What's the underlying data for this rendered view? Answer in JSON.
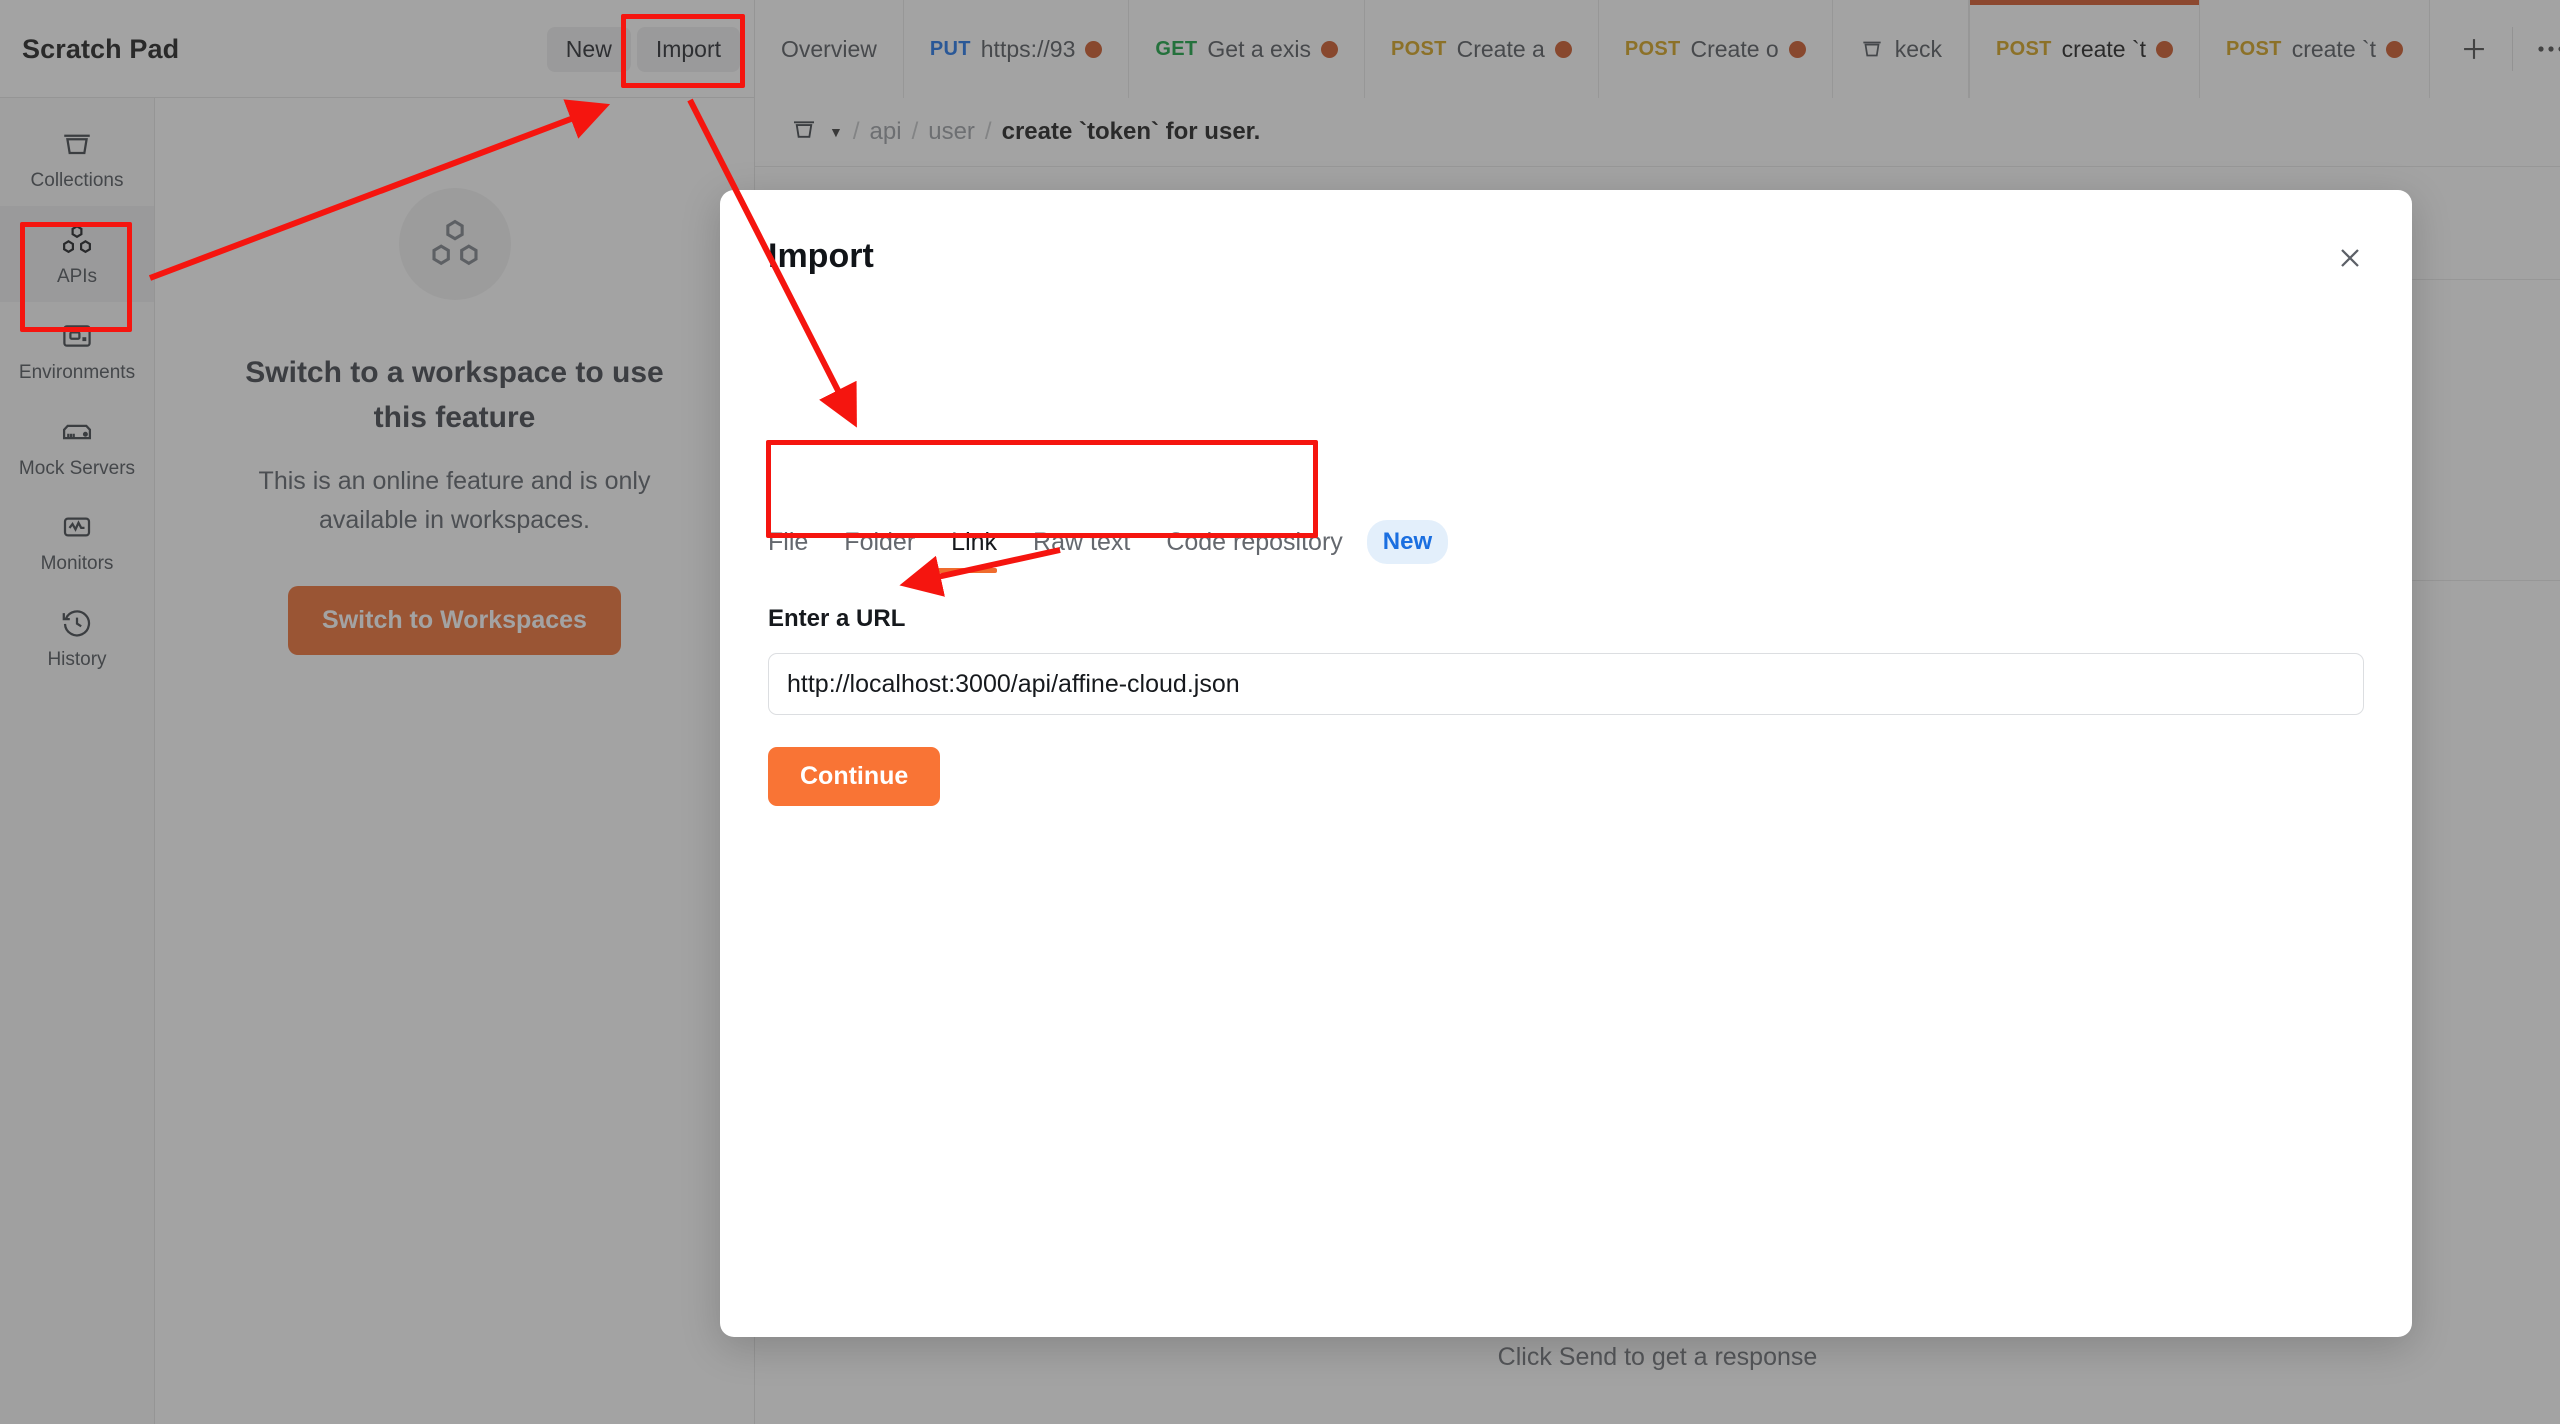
{
  "app": {
    "workspace_title": "Scratch Pad"
  },
  "toolbar": {
    "new_label": "New",
    "import_label": "Import"
  },
  "tabs": [
    {
      "method": "",
      "label": "Overview",
      "method_class": "",
      "dot": false,
      "icon": "",
      "active": false
    },
    {
      "method": "PUT",
      "label": "https://93",
      "method_class": "m-put",
      "dot": true,
      "icon": "",
      "active": false
    },
    {
      "method": "GET",
      "label": "Get a exis",
      "method_class": "m-get",
      "dot": true,
      "icon": "",
      "active": false
    },
    {
      "method": "POST",
      "label": "Create a",
      "method_class": "m-post",
      "dot": true,
      "icon": "",
      "active": false
    },
    {
      "method": "POST",
      "label": "Create o",
      "method_class": "m-post",
      "dot": true,
      "icon": "",
      "active": false
    },
    {
      "method": "",
      "label": "keck",
      "method_class": "",
      "dot": false,
      "icon": "collection-icon",
      "active": false
    },
    {
      "method": "POST",
      "label": "create `t",
      "method_class": "m-post",
      "dot": true,
      "icon": "",
      "active": true
    },
    {
      "method": "POST",
      "label": "create `t",
      "method_class": "m-post",
      "dot": true,
      "icon": "",
      "active": false
    }
  ],
  "tabstrip_actions": {
    "add_tab_icon": "plus-icon",
    "more_tabs_icon": "ellipsis-icon"
  },
  "sidebar": {
    "items": [
      {
        "label": "Collections",
        "icon": "collections-icon",
        "selected": false
      },
      {
        "label": "APIs",
        "icon": "apis-icon",
        "selected": true
      },
      {
        "label": "Environments",
        "icon": "environments-icon",
        "selected": false
      },
      {
        "label": "Mock Servers",
        "icon": "mock-servers-icon",
        "selected": false
      },
      {
        "label": "Monitors",
        "icon": "monitors-icon",
        "selected": false
      },
      {
        "label": "History",
        "icon": "history-icon",
        "selected": false
      }
    ]
  },
  "empty_state": {
    "icon": "apis-hex-icon",
    "title": "Switch to a workspace to use this feature",
    "subtitle": "This is an online feature and is only available in workspaces.",
    "button_label": "Switch to Workspaces"
  },
  "breadcrumb": {
    "collection_icon": "collection-icon",
    "caret_icon": "caret-down-icon",
    "separator": "/",
    "items": [
      "api",
      "user"
    ],
    "current": "create `token` for user."
  },
  "response": {
    "placeholder_text": "Click Send to get a response",
    "icon": "response-empty-icon"
  },
  "modal": {
    "title": "Import",
    "close_icon": "close-icon",
    "tabs": [
      {
        "label": "File",
        "active": false
      },
      {
        "label": "Folder",
        "active": false
      },
      {
        "label": "Link",
        "active": true
      },
      {
        "label": "Raw text",
        "active": false
      },
      {
        "label": "Code repository",
        "active": false
      }
    ],
    "new_badge": "New",
    "field_label": "Enter a URL",
    "url_value": "http://localhost:3000/api/affine-cloud.json",
    "url_placeholder": "Enter a URL",
    "continue_label": "Continue"
  },
  "annotations": {
    "highlight_color": "#f5150f",
    "boxes": [
      "import-button",
      "apis-sidebar-item",
      "url-input"
    ],
    "arrows": [
      "apis-to-import",
      "import-to-url-field",
      "pointer-to-continue"
    ]
  },
  "colors": {
    "accent_orange": "#ef6c2e",
    "continue_orange": "#f97435",
    "active_tab_bar": "#d35424",
    "put_blue": "#1b72e8",
    "get_green": "#10a13e",
    "post_yellow": "#d4a017",
    "unsaved_dot": "#cc5322",
    "new_badge_blue": "#1b6fe0"
  }
}
